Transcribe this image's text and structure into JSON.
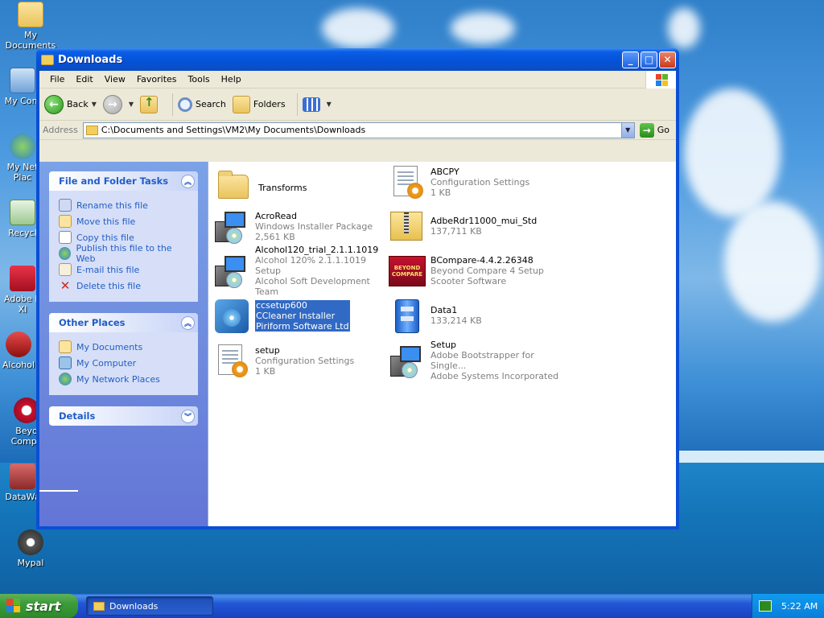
{
  "desktop": {
    "icons": [
      {
        "label": "My Documents"
      },
      {
        "label": "My Com"
      },
      {
        "label": "My Net"
      },
      {
        "label": "Plac"
      },
      {
        "label": "Recycl"
      },
      {
        "label": "Adobe R"
      },
      {
        "label": "XI"
      },
      {
        "label": "Alcohol"
      },
      {
        "label": "Beyo"
      },
      {
        "label": "Compa"
      },
      {
        "label": "DataWa"
      },
      {
        "label": "Mypal"
      }
    ]
  },
  "window": {
    "title": "Downloads",
    "menu": [
      "File",
      "Edit",
      "View",
      "Favorites",
      "Tools",
      "Help"
    ],
    "toolbar": {
      "back_label": "Back",
      "search_label": "Search",
      "folders_label": "Folders"
    },
    "address": {
      "label": "Address",
      "value": "C:\\Documents and Settings\\VM2\\My Documents\\Downloads",
      "go_label": "Go"
    },
    "left_pane": {
      "file_tasks": {
        "title": "File and Folder Tasks",
        "items": [
          "Rename this file",
          "Move this file",
          "Copy this file",
          "Publish this file to the Web",
          "E-mail this file",
          "Delete this file"
        ]
      },
      "other_places": {
        "title": "Other Places",
        "items": [
          "My Documents",
          "My Computer",
          "My Network Places"
        ]
      },
      "details": {
        "title": "Details"
      }
    },
    "files": [
      {
        "name": "Transforms",
        "line2": "",
        "line3": "",
        "icon": "folder-icon"
      },
      {
        "name": "ABCPY",
        "line2": "Configuration Settings",
        "line3": "1 KB",
        "icon": "config-file-icon"
      },
      {
        "name": "AcroRead",
        "line2": "Windows Installer Package",
        "line3": "2,561 KB",
        "icon": "installer-icon"
      },
      {
        "name": "AdbeRdr11000_mui_Std",
        "line2": "137,711 KB",
        "line3": "",
        "icon": "zip-folder-icon"
      },
      {
        "name": "Alcohol120_trial_2.1.1.1019",
        "line2": "Alcohol 120% 2.1.1.1019 Setup",
        "line3": "Alcohol Soft Development Team",
        "icon": "installer-icon"
      },
      {
        "name": "BCompare-4.4.2.26348",
        "line2": "Beyond Compare 4 Setup",
        "line3": "Scooter Software",
        "icon": "beyond-compare-icon"
      },
      {
        "name": "ccsetup600",
        "line2": "CCleaner Installer",
        "line3": "Piriform Software Ltd",
        "icon": "ccleaner-icon"
      },
      {
        "name": "Data1",
        "line2": "133,214 KB",
        "line3": "",
        "icon": "cabinet-icon"
      },
      {
        "name": "setup",
        "line2": "Configuration Settings",
        "line3": "1 KB",
        "icon": "config-file-icon"
      },
      {
        "name": "Setup",
        "line2": "Adobe Bootstrapper for Single...",
        "line3": "Adobe Systems Incorporated",
        "icon": "installer-icon"
      }
    ],
    "bc_icon_text": "BEYOND COMPARE"
  },
  "taskbar": {
    "start_label": "start",
    "task_label": "Downloads",
    "clock": "5:22 AM"
  }
}
